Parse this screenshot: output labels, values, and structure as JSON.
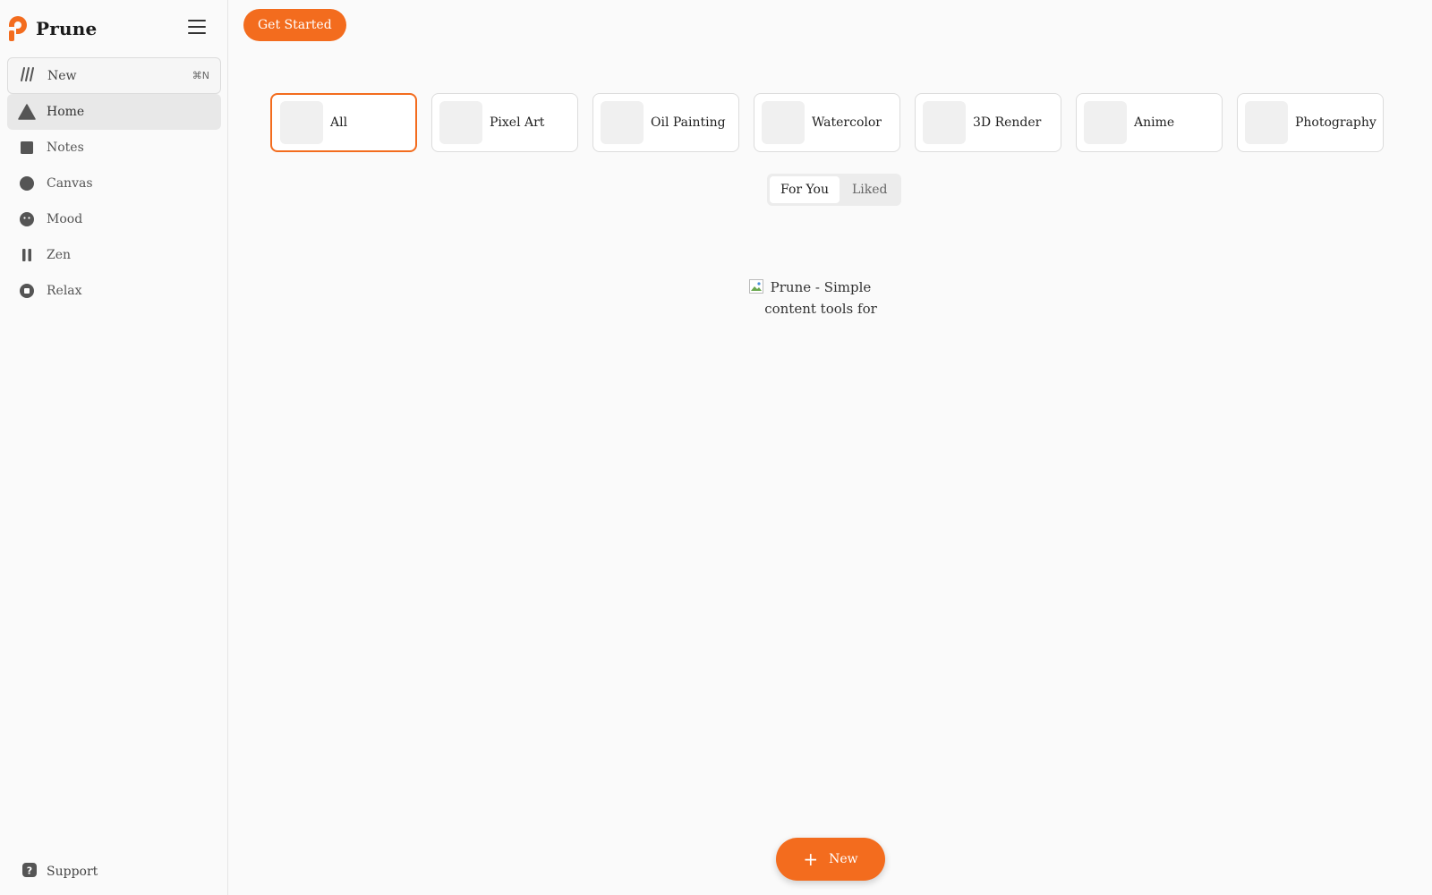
{
  "brand": {
    "name": "Prune",
    "accent": "#f36c1e"
  },
  "sidebar": {
    "new": {
      "label": "New",
      "shortcut": "⌘N",
      "icon": "slashes-icon"
    },
    "items": [
      {
        "label": "Home",
        "icon": "triangle-icon",
        "active": true
      },
      {
        "label": "Notes",
        "icon": "square-icon"
      },
      {
        "label": "Canvas",
        "icon": "circle-icon"
      },
      {
        "label": "Mood",
        "icon": "face-icon"
      },
      {
        "label": "Zen",
        "icon": "pause-icon"
      },
      {
        "label": "Relax",
        "icon": "ring-icon"
      }
    ],
    "support": {
      "label": "Support",
      "icon": "help-icon"
    }
  },
  "header": {
    "cta": "Get Started"
  },
  "styles": [
    {
      "label": "All",
      "active": true
    },
    {
      "label": "Pixel Art"
    },
    {
      "label": "Oil Painting"
    },
    {
      "label": "Watercolor"
    },
    {
      "label": "3D Render"
    },
    {
      "label": "Anime"
    },
    {
      "label": "Photography"
    }
  ],
  "tabs": [
    {
      "label": "For You",
      "active": true
    },
    {
      "label": "Liked"
    }
  ],
  "hero": {
    "alt": "Prune - Simple content tools for"
  },
  "fab": {
    "label": "New"
  }
}
